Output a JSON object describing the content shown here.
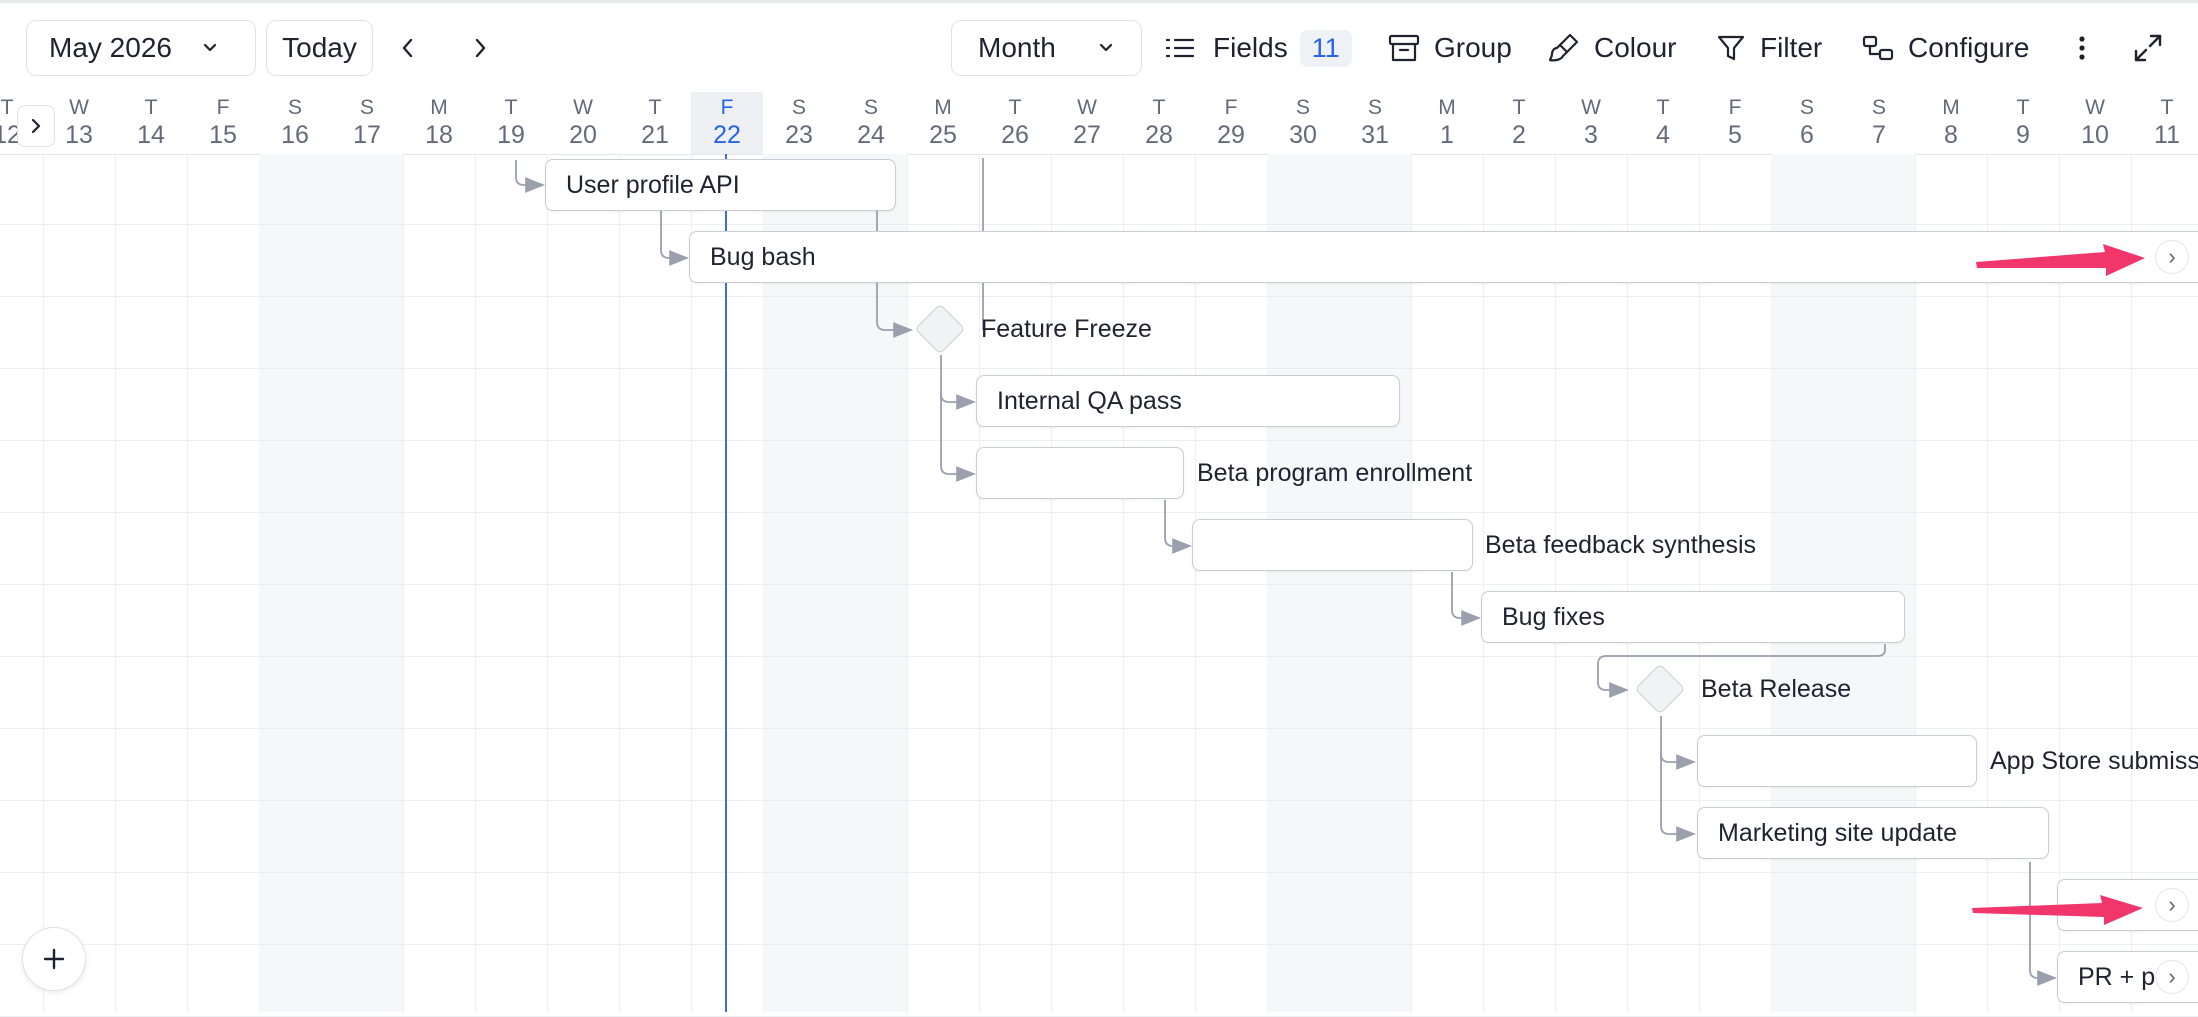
{
  "toolbar": {
    "date_picker": "May 2026",
    "today": "Today",
    "view_mode": "Month",
    "fields_label": "Fields",
    "fields_count": "11",
    "group_label": "Group",
    "colour_label": "Colour",
    "filter_label": "Filter",
    "configure_label": "Configure"
  },
  "timeline": {
    "days": [
      {
        "wd": "T",
        "d": "12"
      },
      {
        "wd": "W",
        "d": "13"
      },
      {
        "wd": "T",
        "d": "14"
      },
      {
        "wd": "F",
        "d": "15"
      },
      {
        "wd": "S",
        "d": "16"
      },
      {
        "wd": "S",
        "d": "17"
      },
      {
        "wd": "M",
        "d": "18"
      },
      {
        "wd": "T",
        "d": "19"
      },
      {
        "wd": "W",
        "d": "20"
      },
      {
        "wd": "T",
        "d": "21"
      },
      {
        "wd": "F",
        "d": "22"
      },
      {
        "wd": "S",
        "d": "23"
      },
      {
        "wd": "S",
        "d": "24"
      },
      {
        "wd": "M",
        "d": "25"
      },
      {
        "wd": "T",
        "d": "26"
      },
      {
        "wd": "W",
        "d": "27"
      },
      {
        "wd": "T",
        "d": "28"
      },
      {
        "wd": "F",
        "d": "29"
      },
      {
        "wd": "S",
        "d": "30"
      },
      {
        "wd": "S",
        "d": "31"
      },
      {
        "wd": "M",
        "d": "1"
      },
      {
        "wd": "T",
        "d": "2"
      },
      {
        "wd": "W",
        "d": "3"
      },
      {
        "wd": "T",
        "d": "4"
      },
      {
        "wd": "F",
        "d": "5"
      },
      {
        "wd": "S",
        "d": "6"
      },
      {
        "wd": "S",
        "d": "7"
      },
      {
        "wd": "M",
        "d": "8"
      },
      {
        "wd": "T",
        "d": "9"
      },
      {
        "wd": "W",
        "d": "10"
      },
      {
        "wd": "T",
        "d": "11"
      }
    ],
    "today": "22"
  },
  "tasks": {
    "user_profile_api": "User profile API",
    "bug_bash": "Bug bash",
    "feature_freeze": "Feature Freeze",
    "internal_qa": "Internal QA pass",
    "beta_enrollment": "Beta program enrollment",
    "beta_feedback": "Beta feedback synthesis",
    "bug_fixes": "Bug fixes",
    "beta_release": "Beta Release",
    "app_store": "App Store submiss",
    "marketing_site": "Marketing site update",
    "pr_task": "PR + p"
  },
  "colors": {
    "accent": "#2563eb",
    "today_line": "#3b6fe0",
    "annotation_arrow": "#f0366a"
  }
}
